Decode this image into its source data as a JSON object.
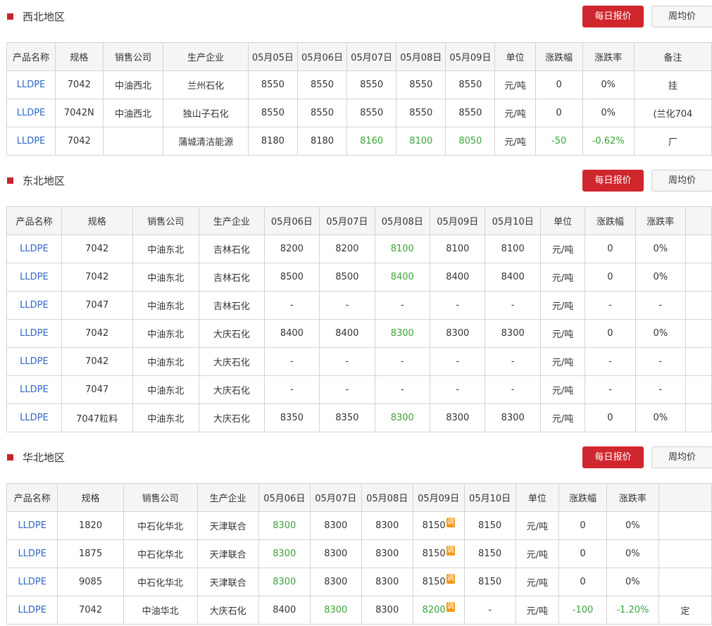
{
  "sections": [
    {
      "title": "西北地区",
      "daily_btn": "每日报价",
      "weekly_btn": "周均价",
      "headers": [
        "产品名称",
        "规格",
        "销售公司",
        "生产企业",
        "05月05日",
        "05月06日",
        "05月07日",
        "05月08日",
        "05月09日",
        "单位",
        "涨跌幅",
        "涨跌率",
        "备注"
      ],
      "rows": [
        [
          "LLDPE",
          "7042",
          "中油西北",
          "兰州石化",
          "8550",
          "8550",
          "8550",
          "8550",
          "8550",
          "元/吨",
          "0",
          "0%",
          "挂"
        ],
        [
          "LLDPE",
          "7042N",
          "中油西北",
          "独山子石化",
          "8550",
          "8550",
          "8550",
          "8550",
          "8550",
          "元/吨",
          "0",
          "0%",
          "(兰化704"
        ],
        [
          "LLDPE",
          "7042",
          "",
          "蒲城清洁能源",
          "8180",
          "8180",
          "8160",
          "8100",
          "8050",
          "元/吨",
          "-50",
          "-0.62%",
          "厂"
        ]
      ]
    },
    {
      "title": "东北地区",
      "daily_btn": "每日报价",
      "weekly_btn": "周均价",
      "headers": [
        "产品名称",
        "规格",
        "销售公司",
        "生产企业",
        "05月06日",
        "05月07日",
        "05月08日",
        "05月09日",
        "05月10日",
        "单位",
        "涨跌幅",
        "涨跌率",
        ""
      ],
      "rows": [
        [
          "LLDPE",
          "7042",
          "中油东北",
          "吉林石化",
          "8200",
          "8200",
          "8100",
          "8100",
          "8100",
          "元/吨",
          "0",
          "0%",
          ""
        ],
        [
          "LLDPE",
          "7042",
          "中油东北",
          "吉林石化",
          "8500",
          "8500",
          "8400",
          "8400",
          "8400",
          "元/吨",
          "0",
          "0%",
          ""
        ],
        [
          "LLDPE",
          "7047",
          "中油东北",
          "吉林石化",
          "-",
          "-",
          "-",
          "-",
          "-",
          "元/吨",
          "-",
          "-",
          ""
        ],
        [
          "LLDPE",
          "7042",
          "中油东北",
          "大庆石化",
          "8400",
          "8400",
          "8300",
          "8300",
          "8300",
          "元/吨",
          "0",
          "0%",
          ""
        ],
        [
          "LLDPE",
          "7042",
          "中油东北",
          "大庆石化",
          "-",
          "-",
          "-",
          "-",
          "-",
          "元/吨",
          "-",
          "-",
          ""
        ],
        [
          "LLDPE",
          "7047",
          "中油东北",
          "大庆石化",
          "-",
          "-",
          "-",
          "-",
          "-",
          "元/吨",
          "-",
          "-",
          ""
        ],
        [
          "LLDPE",
          "7047粒料",
          "中油东北",
          "大庆石化",
          "8350",
          "8350",
          "8300",
          "8300",
          "8300",
          "元/吨",
          "0",
          "0%",
          ""
        ]
      ]
    },
    {
      "title": "华北地区",
      "daily_btn": "每日报价",
      "weekly_btn": "周均价",
      "headers": [
        "产品名称",
        "规格",
        "销售公司",
        "生产企业",
        "05月06日",
        "05月07日",
        "05月08日",
        "05月09日",
        "05月10日",
        "单位",
        "涨跌幅",
        "涨跌率",
        ""
      ],
      "rows": [
        [
          "LLDPE",
          "1820",
          "中石化华北",
          "天津联合",
          "8300",
          "8300",
          "8300",
          "8150",
          "8150",
          "元/吨",
          "0",
          "0%",
          ""
        ],
        [
          "LLDPE",
          "1875",
          "中石化华北",
          "天津联合",
          "8300",
          "8300",
          "8300",
          "8150",
          "8150",
          "元/吨",
          "0",
          "0%",
          ""
        ],
        [
          "LLDPE",
          "9085",
          "中石化华北",
          "天津联合",
          "8300",
          "8300",
          "8300",
          "8150",
          "8150",
          "元/吨",
          "0",
          "0%",
          ""
        ],
        [
          "LLDPE",
          "7042",
          "中油华北",
          "大庆石化",
          "8400",
          "8300",
          "8300",
          "8200",
          "-",
          "元/吨",
          "-100",
          "-1.20%",
          "定"
        ]
      ]
    }
  ],
  "adjust_tag": "调",
  "colors": {
    "accent": "#d0262d",
    "link": "#2f67c4",
    "down": "#3aa33a"
  }
}
